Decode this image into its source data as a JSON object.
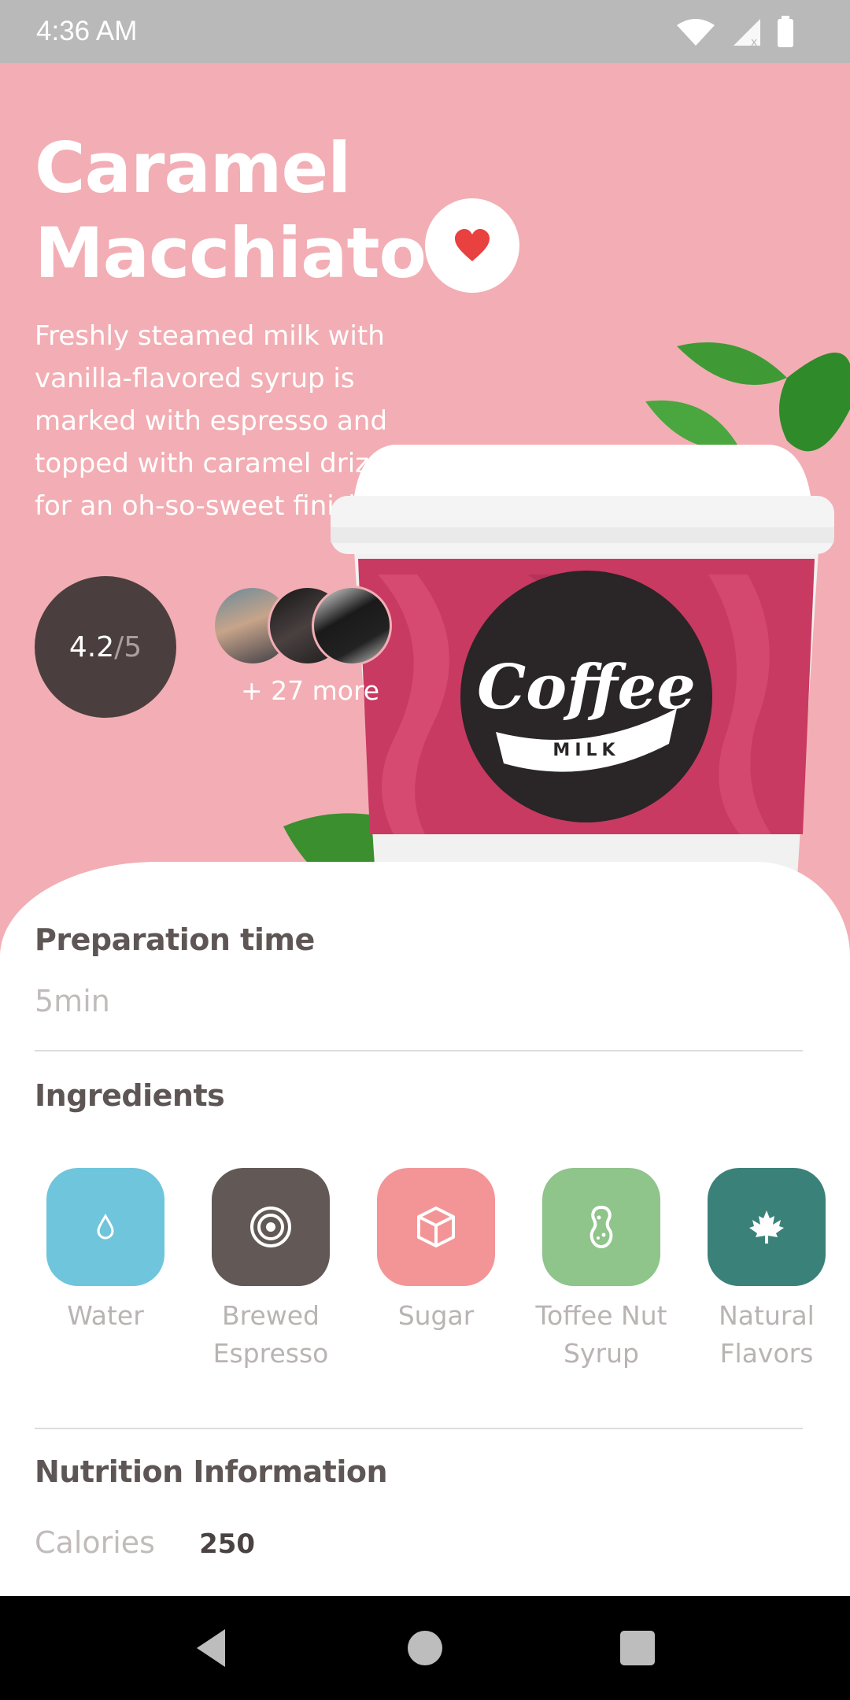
{
  "status_bar": {
    "time": "4:36 AM"
  },
  "product": {
    "title_line1": "Caramel",
    "title_line2": "Macchiato",
    "description": "Freshly steamed milk with vanilla-flavored syrup is marked with espresso and topped with caramel drizzle for an oh-so-sweet finish.",
    "rating_value": "4.2",
    "rating_denom": "/5",
    "likers_more": "+ 27 more",
    "cup_logo": "Coffee",
    "cup_logo_sub": "MILK"
  },
  "preparation": {
    "title": "Preparation time",
    "value": "5min"
  },
  "ingredients": {
    "title": "Ingredients",
    "items": [
      {
        "name": "Water",
        "icon": "droplet-icon",
        "color": "#6fc5dc"
      },
      {
        "name_line1": "Brewed",
        "name_line2": "Espresso",
        "icon": "target-icon",
        "color": "#625856"
      },
      {
        "name": "Sugar",
        "icon": "cube-icon",
        "color": "#f39597"
      },
      {
        "name_line1": "Toffee Nut",
        "name_line2": "Syrup",
        "icon": "peanut-icon",
        "color": "#8fc48b"
      },
      {
        "name_line1": "Natural",
        "name_line2": "Flavors",
        "icon": "maple-leaf-icon",
        "color": "#3a8279"
      }
    ]
  },
  "nutrition": {
    "title": "Nutrition Information",
    "calories_label": "Calories",
    "calories_value": "250"
  },
  "colors": {
    "hero_bg": "#f2aeb4",
    "heart": "#e8413f",
    "rating_bg": "#4a3f3e"
  }
}
